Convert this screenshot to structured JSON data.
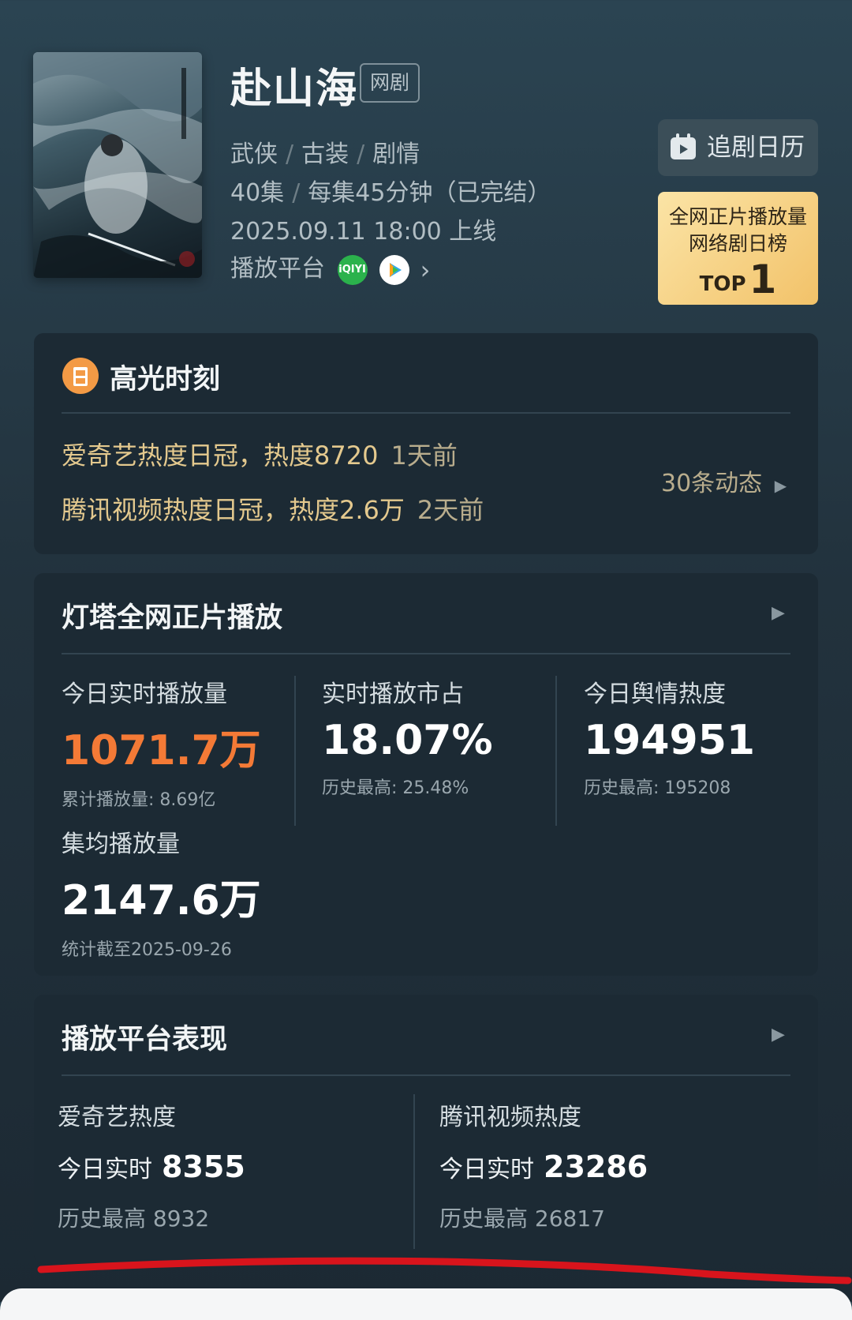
{
  "drama": {
    "title": "赴山海",
    "tag": "网剧",
    "genres": [
      "武侠",
      "古装",
      "剧情"
    ],
    "episodes": "40集",
    "duration": "每集45分钟（已完结）",
    "release": "2025.09.11 18:00 上线",
    "platform_label": "播放平台",
    "platforms": [
      {
        "name": "iqiyi",
        "icon": "iqiyi-logo-icon",
        "color": "#2bb24c"
      },
      {
        "name": "tencent",
        "icon": "tencent-video-logo-icon",
        "color": "#ffffff"
      }
    ]
  },
  "calendar_button": {
    "label": "追剧日历",
    "icon": "calendar-icon"
  },
  "rank_badge": {
    "line1": "全网正片播放量",
    "line2": "网络剧日榜",
    "top_label": "TOP",
    "rank": "1"
  },
  "highlights": {
    "title": "高光时刻",
    "items": [
      {
        "text": "爱奇艺热度日冠，热度8720",
        "ago": "1天前"
      },
      {
        "text": "腾讯视频热度日冠，热度2.6万",
        "ago": "2天前"
      }
    ],
    "more": "30条动态"
  },
  "lighthouse": {
    "title": "灯塔全网正片播放",
    "stats": [
      {
        "label": "今日实时播放量",
        "value": "1071.7万",
        "sub": "累计播放量: 8.69亿"
      },
      {
        "label": "实时播放市占",
        "value": "18.07%",
        "sub": "历史最高: 25.48%"
      },
      {
        "label": "今日舆情热度",
        "value": "194951",
        "sub": "历史最高: 195208"
      },
      {
        "label": "集均播放量",
        "value": "2147.6万",
        "sub": "统计截至2025-09-26"
      }
    ]
  },
  "platform_perf": {
    "title": "播放平台表现",
    "items": [
      {
        "name": "爱奇艺热度",
        "now_label": "今日实时",
        "now_value": "8355",
        "hist": "历史最高 8932"
      },
      {
        "name": "腾讯视频热度",
        "now_label": "今日实时",
        "now_value": "23286",
        "hist": "历史最高 26817"
      }
    ]
  },
  "colors": {
    "accent_orange": "#f47a36",
    "highlight_gold": "#e4c98e",
    "badge_gold": "#f2c269",
    "card_bg": "#1c2a34",
    "underline_red": "#d8141c"
  }
}
